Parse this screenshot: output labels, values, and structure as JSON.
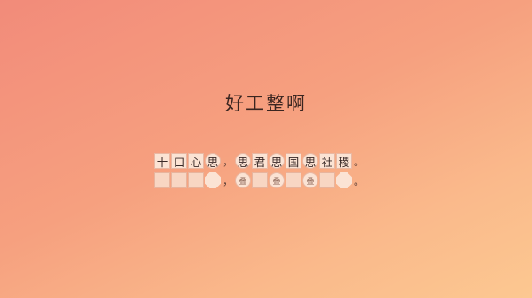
{
  "title": "好工整啊",
  "row1": {
    "group1": [
      "十",
      "口",
      "心",
      "思"
    ],
    "sep1": "，",
    "group2": [
      "思",
      "君",
      "思",
      "国",
      "思",
      "社",
      "稷"
    ],
    "end": "。"
  },
  "row2": {
    "group1_shapes": [
      "square",
      "square",
      "square",
      "octagon"
    ],
    "sep1": "，",
    "hint": "叠",
    "end": "。"
  }
}
